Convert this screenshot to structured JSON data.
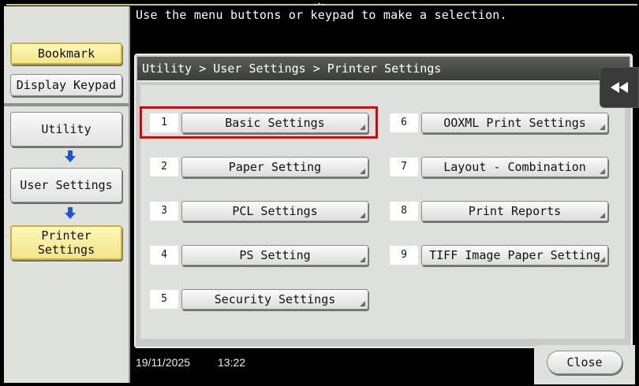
{
  "instruction": "Use the menu buttons or keypad to make a selection.",
  "sidebar": {
    "bookmark": "Bookmark",
    "display_keypad": "Display Keypad",
    "nav": [
      {
        "label": "Utility"
      },
      {
        "label": "User Settings"
      },
      {
        "label": "Printer Settings"
      }
    ]
  },
  "breadcrumb": "Utility > User Settings > Printer Settings",
  "options": [
    {
      "num": "1",
      "label": "Basic Settings"
    },
    {
      "num": "2",
      "label": "Paper Setting"
    },
    {
      "num": "3",
      "label": "PCL Settings"
    },
    {
      "num": "4",
      "label": "PS Setting"
    },
    {
      "num": "5",
      "label": "Security Settings"
    },
    {
      "num": "6",
      "label": "OOXML Print Settings"
    },
    {
      "num": "7",
      "label": "Layout - Combination"
    },
    {
      "num": "8",
      "label": "Print Reports"
    },
    {
      "num": "9",
      "label": "TIFF Image Paper Setting"
    }
  ],
  "footer": {
    "date": "19/11/2025",
    "time": "13:22",
    "close": "Close"
  },
  "colors": {
    "selection": "#e00000",
    "active_nav": "#f2e58a",
    "arrow": "#1a56d6"
  }
}
